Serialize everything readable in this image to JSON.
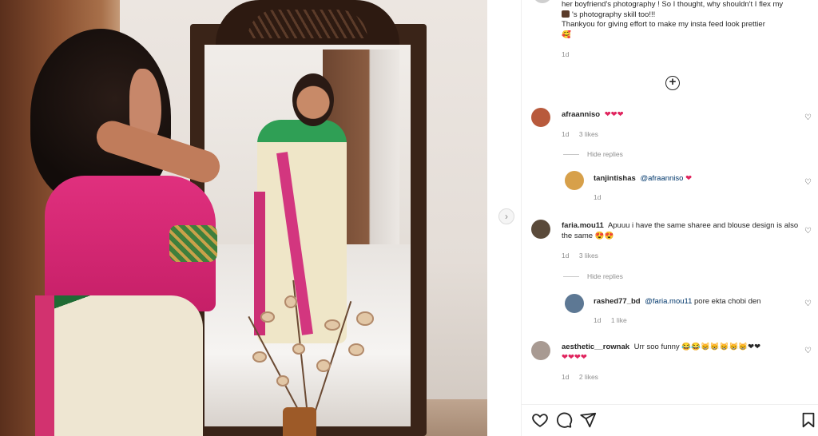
{
  "caption": {
    "lines": [
      "her boyfriend's photography ! So I thought, why shouldn't I flex my",
      "'s photography skill too!!!",
      "Thankyou  for giving effort to make my insta feed look prettier"
    ],
    "emoji_line": "🥰",
    "time": "1d"
  },
  "more_label": "+",
  "comments": [
    {
      "user": "afraanniso",
      "text": "❤❤❤",
      "time": "1d",
      "likes": "3 likes",
      "avatar_color": "#b85a3c"
    },
    {
      "user": "tanjintishas",
      "mention": "@afraanniso",
      "text": "❤",
      "time": "1d",
      "avatar_color": "#d7a04a"
    },
    {
      "user": "faria.mou11",
      "text": "Apuuu i have the same sharee and blouse design is also the same 😍😍",
      "time": "1d",
      "likes": "3 likes",
      "avatar_color": "#5a4a3a"
    },
    {
      "user": "rashed77_bd",
      "mention": "@faria.mou11",
      "text": "pore ekta chobi den",
      "time": "1d",
      "likes": "1 like",
      "avatar_color": "#5d7894"
    },
    {
      "user": "aesthetic__rownak",
      "text": "Urr soo funny 😂😂😸😸😸😸😸❤❤",
      "text2": "❤❤❤❤",
      "time": "1d",
      "likes": "2 likes",
      "avatar_color": "#a89a92"
    }
  ],
  "hide_replies_label": "Hide replies",
  "nav_arrow": "›",
  "icons": {
    "like": "heart-outline-icon",
    "comment": "comment-bubble-icon",
    "share": "paper-plane-icon",
    "save": "bookmark-icon"
  },
  "colors": {
    "text": "#262626",
    "meta": "#8e8e8e",
    "mention": "#00376b",
    "heart": "#e0245e"
  }
}
